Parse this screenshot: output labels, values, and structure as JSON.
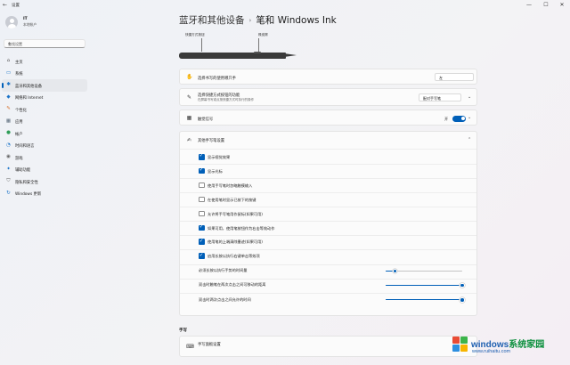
{
  "window": {
    "app_title": "设置",
    "controls": {
      "back": "←",
      "minimize": "—",
      "maximize": "☐",
      "close": "✕"
    }
  },
  "user": {
    "name": "IT",
    "account": "本地帐户"
  },
  "search": {
    "placeholder": "查找设置"
  },
  "sidebar": {
    "items": [
      {
        "label": "主页",
        "icon": "home-icon",
        "glyph": "⌂",
        "color": "#555555"
      },
      {
        "label": "系统",
        "icon": "monitor-icon",
        "glyph": "▭",
        "color": "#1a73c8"
      },
      {
        "label": "蓝牙和其他设备",
        "icon": "bluetooth-icon",
        "glyph": "✱",
        "color": "#1a73c8",
        "active": true
      },
      {
        "label": "网络和 Internet",
        "icon": "wifi-icon",
        "glyph": "◆",
        "color": "#1a73c8"
      },
      {
        "label": "个性化",
        "icon": "brush-icon",
        "glyph": "✎",
        "color": "#d7702c"
      },
      {
        "label": "应用",
        "icon": "apps-icon",
        "glyph": "▦",
        "color": "#5a6b7a"
      },
      {
        "label": "帐户",
        "icon": "account-icon",
        "glyph": "●",
        "color": "#2e9d57"
      },
      {
        "label": "时间和语言",
        "icon": "clock-globe-icon",
        "glyph": "◔",
        "color": "#1a73c8"
      },
      {
        "label": "游戏",
        "icon": "gamepad-icon",
        "glyph": "◉",
        "color": "#666666"
      },
      {
        "label": "辅助功能",
        "icon": "accessibility-icon",
        "glyph": "✦",
        "color": "#1a73c8"
      },
      {
        "label": "隐私和安全性",
        "icon": "shield-icon",
        "glyph": "⛉",
        "color": "#666666"
      },
      {
        "label": "Windows 更新",
        "icon": "update-icon",
        "glyph": "↻",
        "color": "#1a73c8"
      }
    ]
  },
  "breadcrumb": {
    "parent": "蓝牙和其他设备",
    "separator": "›",
    "current": "笔和 Windows Ink"
  },
  "pen_diagram": {
    "shortcut_label": "快捷方式按钮",
    "eraser_label": "橡皮擦"
  },
  "settings": {
    "handedness": {
      "title": "选择书写的使用哪只手",
      "value": "左",
      "icon": "hand-icon",
      "glyph": "✋"
    },
    "shortcut": {
      "title": "选择快捷方式按钮的功能",
      "desc": "在屏幕书写或点按快捷方式时执行的操作",
      "value": "配对手写笔",
      "icon": "pen-icon",
      "glyph": "✎"
    },
    "haptic": {
      "title": "触觉信号",
      "state": "开",
      "on": true,
      "icon": "haptic-icon",
      "glyph": "▦"
    },
    "handwriting": {
      "title": "其他手写笔设置",
      "icon": "pen-settings-icon",
      "glyph": "✍",
      "options": [
        {
          "label": "显示视觉效果",
          "checked": true
        },
        {
          "label": "显示光标",
          "checked": true
        },
        {
          "label": "使用手写笔时忽略触摸输入",
          "checked": false
        },
        {
          "label": "在使用笔时显示已按下的按键",
          "checked": false
        },
        {
          "label": "允许将手写笔用作鼠标(如果可用)",
          "checked": false
        },
        {
          "label": "如果可用，使用笔按钮作为右击等效动作",
          "checked": true
        },
        {
          "label": "使用笔的上端清除墨迹(如果可用)",
          "checked": true
        },
        {
          "label": "启用长按以执行右键单击等效项",
          "checked": true
        }
      ],
      "sliders": [
        {
          "label": "必须长按以执行手势的时间量",
          "value": 0.12
        },
        {
          "label": "双击时触笔在两次点击之间可移动的距离",
          "value": 1.0
        },
        {
          "label": "双击时两次点击之间允许的时间",
          "value": 1.0
        }
      ]
    }
  },
  "related_section": {
    "title": "手写",
    "item_title": "手写面板设置",
    "item_desc": "",
    "icon": "handwriting-panel-icon",
    "glyph": "⌨"
  },
  "watermark": {
    "line1_a": "windows",
    "line1_b": "系统家园",
    "line2": "www.ruihaitu.com"
  }
}
